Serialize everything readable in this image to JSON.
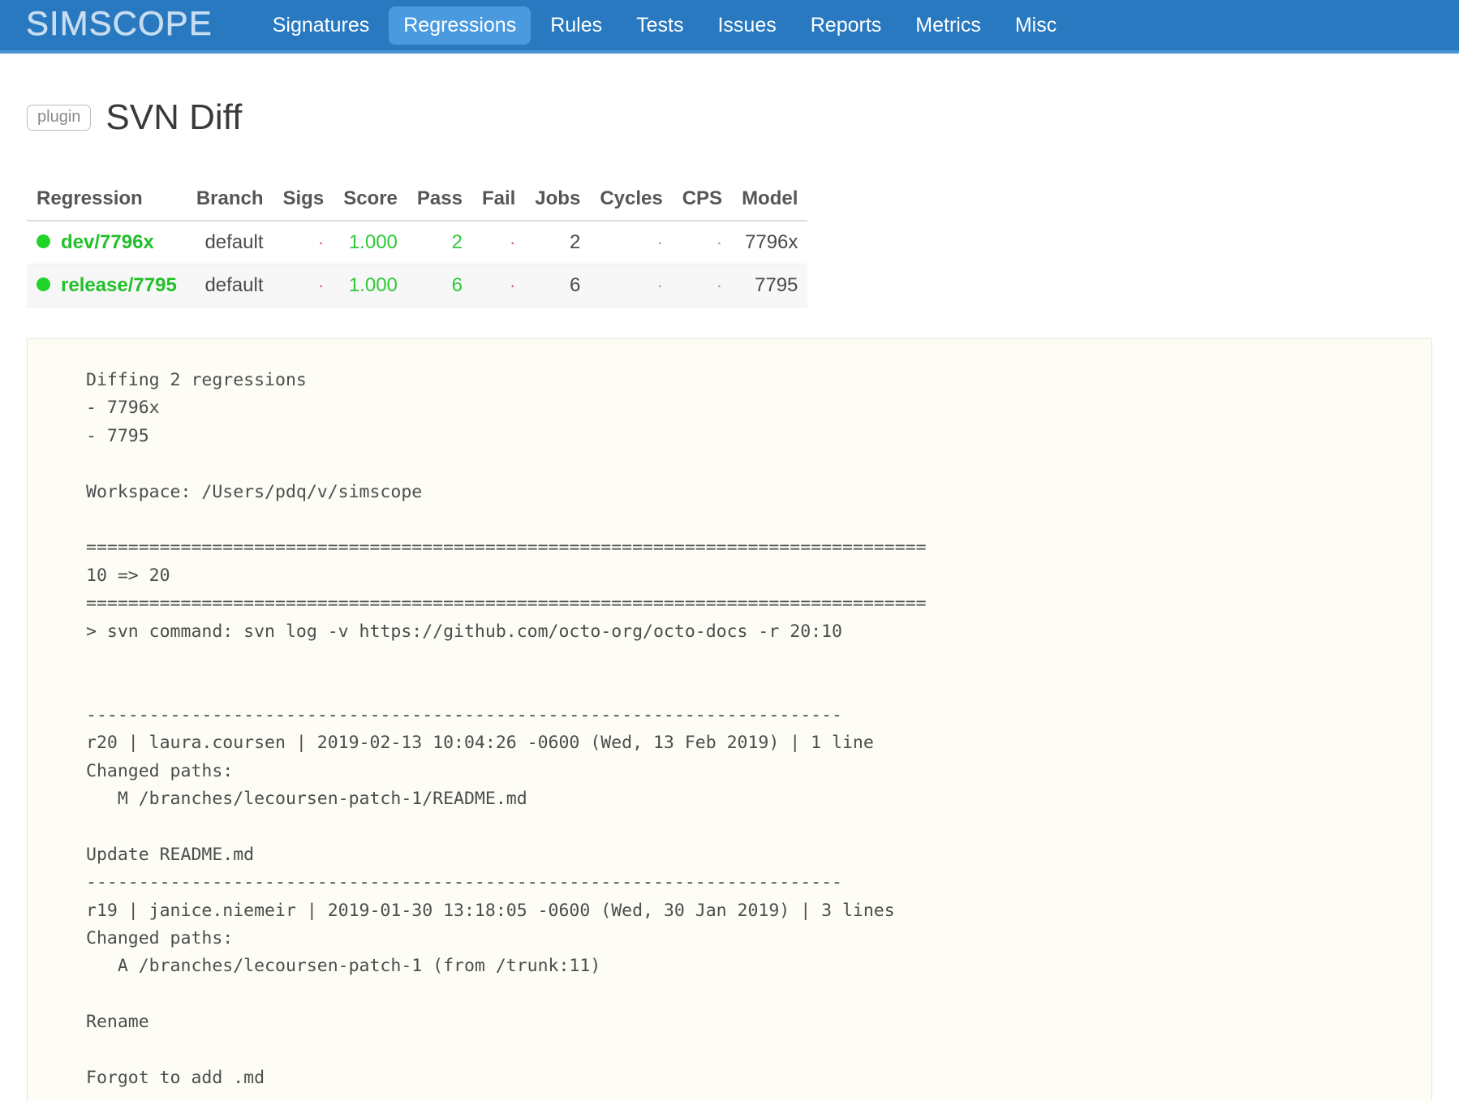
{
  "nav": {
    "brand": "SIMSCOPE",
    "items": [
      {
        "label": "Signatures",
        "active": false
      },
      {
        "label": "Regressions",
        "active": true
      },
      {
        "label": "Rules",
        "active": false
      },
      {
        "label": "Tests",
        "active": false
      },
      {
        "label": "Issues",
        "active": false
      },
      {
        "label": "Reports",
        "active": false
      },
      {
        "label": "Metrics",
        "active": false
      },
      {
        "label": "Misc",
        "active": false
      }
    ],
    "accent_color": "#2879c0",
    "active_color": "#4a9ae0"
  },
  "header": {
    "badge": "plugin",
    "title": "SVN Diff"
  },
  "table": {
    "columns": [
      "Regression",
      "Branch",
      "Sigs",
      "Score",
      "Pass",
      "Fail",
      "Jobs",
      "Cycles",
      "CPS",
      "Model"
    ],
    "rows": [
      {
        "status": "green",
        "regression": "dev/7796x",
        "branch": "default",
        "sigs": "·",
        "score": "1.000",
        "pass": "2",
        "fail": "·",
        "jobs": "2",
        "cycles": "·",
        "cps": "·",
        "model": "7796x"
      },
      {
        "status": "green",
        "regression": "release/7795",
        "branch": "default",
        "sigs": "·",
        "score": "1.000",
        "pass": "6",
        "fail": "·",
        "jobs": "6",
        "cycles": "·",
        "cps": "·",
        "model": "7795"
      }
    ]
  },
  "console": {
    "text": "Diffing 2 regressions\n- 7796x\n- 7795\n\nWorkspace: /Users/pdq/v/simscope\n\n================================================================================\n10 => 20\n================================================================================\n> svn command: svn log -v https://github.com/octo-org/octo-docs -r 20:10\n\n\n------------------------------------------------------------------------\nr20 | laura.coursen | 2019-02-13 10:04:26 -0600 (Wed, 13 Feb 2019) | 1 line\nChanged paths:\n   M /branches/lecoursen-patch-1/README.md\n\nUpdate README.md\n------------------------------------------------------------------------\nr19 | janice.niemeir | 2019-01-30 13:18:05 -0600 (Wed, 30 Jan 2019) | 3 lines\nChanged paths:\n   A /branches/lecoursen-patch-1 (from /trunk:11)\n\nRename\n\nForgot to add .md"
  }
}
